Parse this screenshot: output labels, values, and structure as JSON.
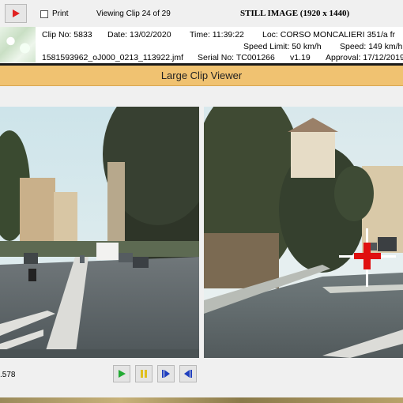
{
  "toolbar": {
    "print_label": "Print",
    "viewing_label": "Viewing Clip 24 of 29",
    "image_info": "STILL IMAGE (1920 x 1440)"
  },
  "meta": {
    "clip_no": "Clip No: 5833",
    "date": "Date: 13/02/2020",
    "time": "Time: 11:39:22",
    "location": "Loc: CORSO MONCALIERI 351/a fr",
    "speed_limit": "Speed Limit: 50 km/h",
    "speed": "Speed: 149 km/h",
    "filename": "1581593962_oJ000_0213_113922.jmf",
    "serial": "Serial No: TC001266",
    "version": "v1.19",
    "approval": "Approval: 17/12/2019"
  },
  "viewer": {
    "title": "Large Clip Viewer"
  },
  "footer": {
    "readout": ".578"
  },
  "colors": {
    "title_band": "#f0c271",
    "play_icon": "#e02020",
    "transport_play": "#22aa33",
    "transport_pause": "#e0c020",
    "transport_nav": "#1f3fbf",
    "crosshair": "#e01010"
  },
  "icons": [
    "play-icon",
    "play-icon",
    "pause-icon",
    "step-forward-icon",
    "step-back-icon",
    "crosshair-icon"
  ]
}
